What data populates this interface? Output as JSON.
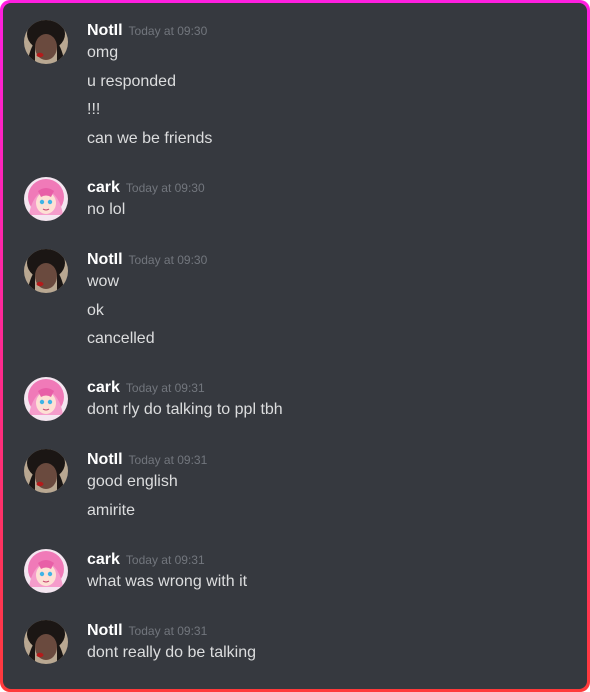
{
  "messages": [
    {
      "username": "NotIl",
      "timestamp": "Today at 09:30",
      "avatar": "person-photo",
      "lines": [
        "omg",
        "u responded",
        "!!!",
        "can we be friends"
      ]
    },
    {
      "username": "cark",
      "timestamp": "Today at 09:30",
      "avatar": "anime-pink-hair",
      "lines": [
        "no lol"
      ]
    },
    {
      "username": "NotIl",
      "timestamp": "Today at 09:30",
      "avatar": "person-photo",
      "lines": [
        "wow",
        "ok",
        "cancelled"
      ]
    },
    {
      "username": "cark",
      "timestamp": "Today at 09:31",
      "avatar": "anime-pink-hair",
      "lines": [
        "dont rly do talking to ppl tbh"
      ]
    },
    {
      "username": "NotIl",
      "timestamp": "Today at 09:31",
      "avatar": "person-photo",
      "lines": [
        "good english",
        "amirite"
      ]
    },
    {
      "username": "cark",
      "timestamp": "Today at 09:31",
      "avatar": "anime-pink-hair",
      "lines": [
        "what was wrong with it"
      ]
    },
    {
      "username": "NotIl",
      "timestamp": "Today at 09:31",
      "avatar": "person-photo",
      "lines": [
        "dont really do be talking"
      ]
    }
  ],
  "colors": {
    "background": "#36393f",
    "username": "#ffffff",
    "timestamp": "#72767d",
    "message_text": "#dcddde",
    "border_top": "#ff1fe0",
    "border_bottom": "#ff3a3a"
  }
}
